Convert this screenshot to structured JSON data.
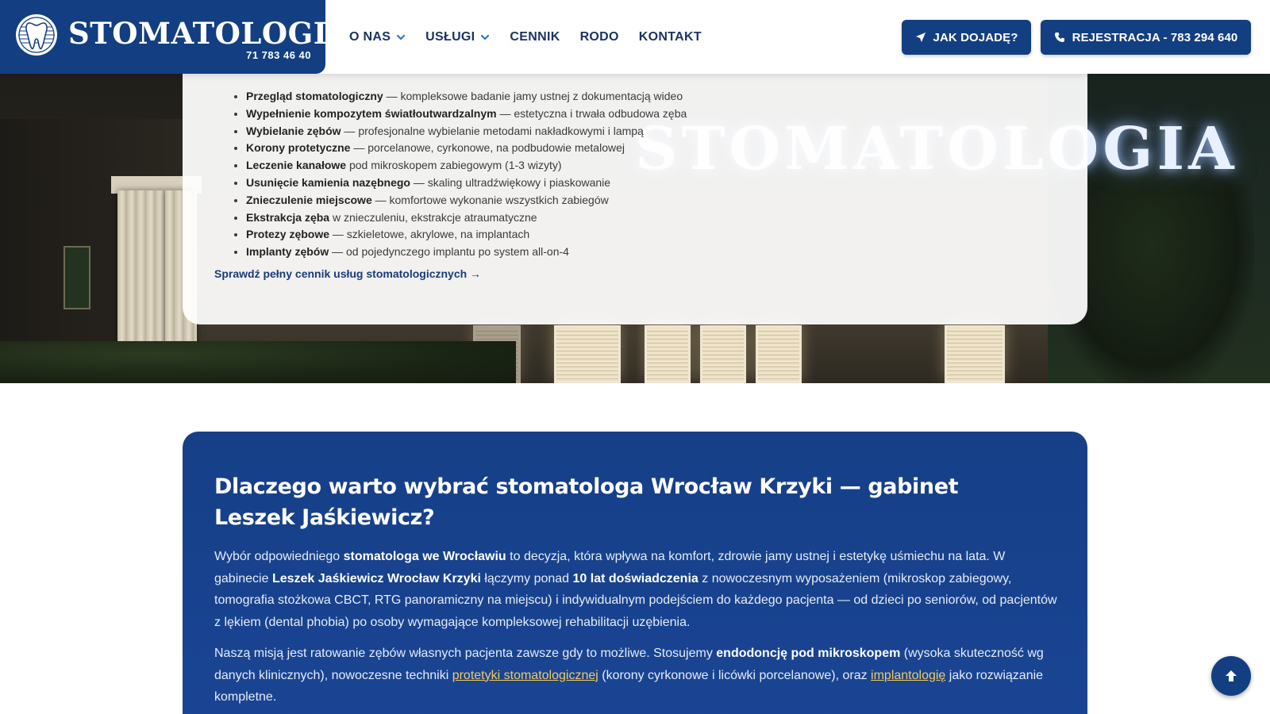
{
  "header": {
    "logo_name": "STOMATOLOGIA",
    "logo_phone": "71 783 46 40",
    "nav": [
      {
        "label": "O NAS",
        "has_dropdown": true
      },
      {
        "label": "USŁUGI",
        "has_dropdown": true
      },
      {
        "label": "CENNIK",
        "has_dropdown": false
      },
      {
        "label": "RODO",
        "has_dropdown": false
      },
      {
        "label": "KONTAKT",
        "has_dropdown": false
      }
    ],
    "btn_directions": "JAK DOJADĘ?",
    "btn_register": "REJESTRACJA - 783 294 640"
  },
  "hero": {
    "sign_text": "STOMATOLOGIA"
  },
  "services": {
    "items": [
      {
        "name": "Przegląd stomatologiczny",
        "desc": " — kompleksowe badanie jamy ustnej z dokumentacją wideo"
      },
      {
        "name": "Wypełnienie kompozytem światłoutwardzalnym",
        "desc": " — estetyczna i trwała odbudowa zęba"
      },
      {
        "name": "Wybielanie zębów",
        "desc": " — profesjonalne wybielanie metodami nakładkowymi i lampą"
      },
      {
        "name": "Korony protetyczne",
        "desc": " — porcelanowe, cyrkonowe, na podbudowie metalowej"
      },
      {
        "name": "Leczenie kanałowe",
        "desc": " pod mikroskopem zabiegowym (1-3 wizyty)"
      },
      {
        "name": "Usunięcie kamienia nazębnego",
        "desc": " — skaling ultradźwiękowy i piaskowanie"
      },
      {
        "name": "Znieczulenie miejscowe",
        "desc": " — komfortowe wykonanie wszystkich zabiegów"
      },
      {
        "name": "Ekstrakcja zęba",
        "desc": " w znieczuleniu, ekstrakcje atraumatyczne"
      },
      {
        "name": "Protezy zębowe",
        "desc": " — szkieletowe, akrylowe, na implantach"
      },
      {
        "name": "Implanty zębów",
        "desc": " — od pojedynczego implantu po system all-on-4"
      }
    ],
    "price_link": "Sprawdź pełny cennik usług stomatologicznych →"
  },
  "why": {
    "title": "Dlaczego warto wybrać stomatologa Wrocław Krzyki — gabinet Leszek Jaśkiewicz?",
    "p1": {
      "t1": "Wybór odpowiedniego ",
      "b1": "stomatologa we Wrocławiu",
      "t2": " to decyzja, która wpływa na komfort, zdrowie jamy ustnej i estetykę uśmiechu na lata. W gabinecie ",
      "b2": "Leszek Jaśkiewicz Wrocław Krzyki",
      "t3": " łączymy ponad ",
      "b3": "10 lat doświadczenia",
      "t4": " z nowoczesnym wyposażeniem (mikroskop zabiegowy, tomografia stożkowa CBCT, RTG panoramiczny na miejscu) i indywidualnym podejściem do każdego pacjenta — od dzieci po seniorów, od pacjentów z lękiem (dental phobia) po osoby wymagające kompleksowej rehabilitacji uzębienia."
    },
    "p2": {
      "t1": "Naszą misją jest ratowanie zębów własnych pacjenta zawsze gdy to możliwe. Stosujemy ",
      "b1": "endodoncję pod mikroskopem",
      "t2": " (wysoka skuteczność wg danych klinicznych), nowoczesne techniki ",
      "link1": "protetyki stomatologicznej",
      "t3": " (korony cyrkonowe i licówki porcelanowe), oraz ",
      "link2": "implantologię",
      "t4": " jako rozwiązanie kompletne."
    }
  },
  "colors": {
    "brand_blue": "#133f82",
    "link_gold": "#f2cc5c",
    "nav_text": "#1b3463"
  },
  "icons": {
    "logo": "tooth-icon",
    "directions": "location-arrow-icon",
    "phone": "phone-icon",
    "scroll_top": "arrow-up-icon",
    "dropdown": "chevron-down-icon"
  }
}
